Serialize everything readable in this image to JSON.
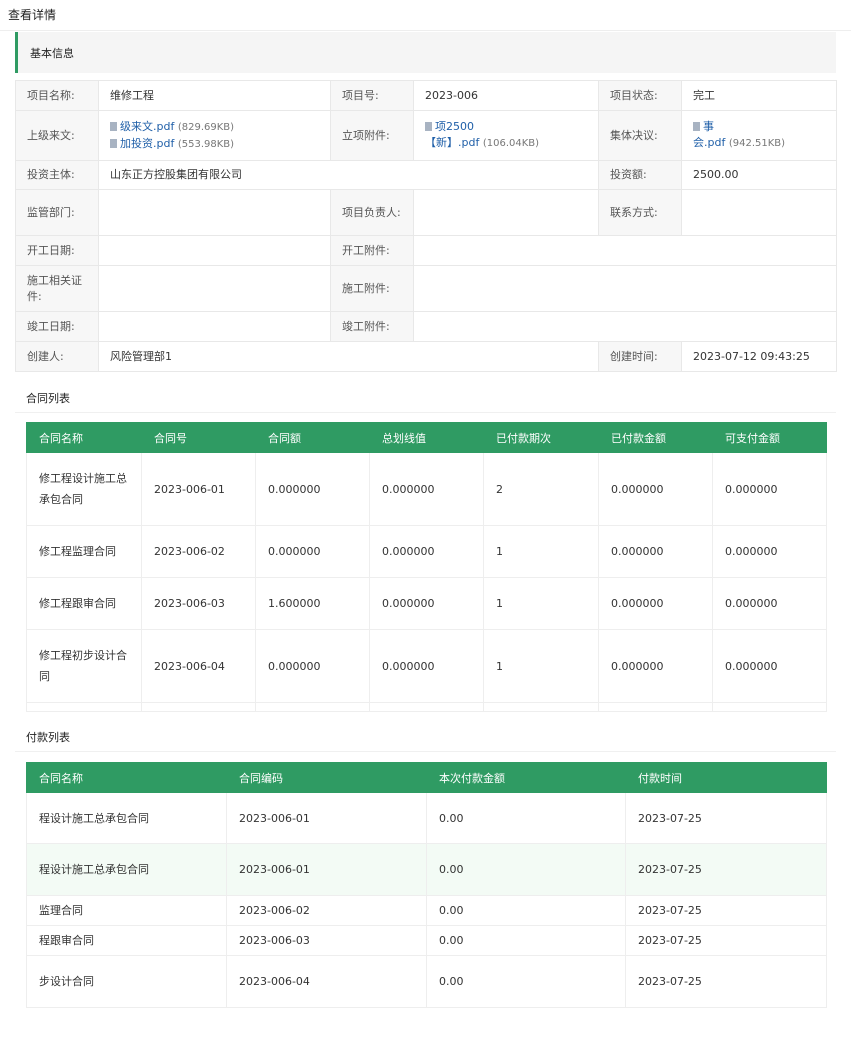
{
  "page_title": "查看详情",
  "section_title": "基本信息",
  "info": {
    "project_name_label": "项目名称:",
    "project_name": "维修工程",
    "project_no_label": "项目号:",
    "project_no": "2023-006",
    "project_status_label": "项目状态:",
    "project_status": "完工",
    "superior_doc_label": "上级来文:",
    "superior_doc_file1": "级来文.pdf",
    "superior_doc_file1_size": "(829.69KB)",
    "superior_doc_file2": "加投资.pdf",
    "superior_doc_file2_size": "(553.98KB)",
    "approval_label": "立项附件:",
    "approval_file_line1": "项2500",
    "approval_file_line2": "【新】.pdf",
    "approval_file_size": "(106.04KB)",
    "collective_label": "集体决议:",
    "collective_file_line1": "事",
    "collective_file_line2": "会.pdf",
    "collective_file_size": "(942.51KB)",
    "investor_label": "投资主体:",
    "investor": "山东正方控股集团有限公司",
    "investment_label": "投资额:",
    "investment": "2500.00",
    "supervisor_label": "监管部门:",
    "supervisor": "",
    "manager_label": "项目负责人:",
    "manager": "",
    "contact_label": "联系方式:",
    "contact": "",
    "start_date_label": "开工日期:",
    "start_date": "",
    "start_attach_label": "开工附件:",
    "start_attach": "",
    "permit_label": "施工相关证件:",
    "permit": "",
    "construction_attach_label": "施工附件:",
    "construction_attach": "",
    "completion_date_label": "竣工日期:",
    "completion_date": "",
    "completion_attach_label": "竣工附件:",
    "completion_attach": "",
    "creator_label": "创建人:",
    "creator": "风险管理部1",
    "created_time_label": "创建时间:",
    "created_time": "2023-07-12 09:43:25"
  },
  "contracts": {
    "title": "合同列表",
    "headers": [
      "合同名称",
      "合同号",
      "合同额",
      "总划线值",
      "已付款期次",
      "已付款金额",
      "可支付金额"
    ],
    "rows": [
      [
        "修工程设计施工总承包合同",
        "2023-006-01",
        "0.000000",
        "0.000000",
        "2",
        "0.000000",
        "0.000000"
      ],
      [
        "修工程监理合同",
        "2023-006-02",
        "0.000000",
        "0.000000",
        "1",
        "0.000000",
        "0.000000"
      ],
      [
        "修工程跟审合同",
        "2023-006-03",
        "1.600000",
        "0.000000",
        "1",
        "0.000000",
        "0.000000"
      ],
      [
        "修工程初步设计合同",
        "2023-006-04",
        "0.000000",
        "0.000000",
        "1",
        "0.000000",
        "0.000000"
      ]
    ]
  },
  "payments": {
    "title": "付款列表",
    "headers": [
      "合同名称",
      "合同编码",
      "本次付款金额",
      "付款时间"
    ],
    "rows": [
      [
        "程设计施工总承包合同",
        "2023-006-01",
        "0.00",
        "2023-07-25"
      ],
      [
        "程设计施工总承包合同",
        "2023-006-01",
        "0.00",
        "2023-07-25"
      ],
      [
        "监理合同",
        "2023-006-02",
        "0.00",
        "2023-07-25"
      ],
      [
        "程跟审合同",
        "2023-006-03",
        "0.00",
        "2023-07-25"
      ],
      [
        "步设计合同",
        "2023-006-04",
        "0.00",
        "2023-07-25"
      ]
    ]
  }
}
